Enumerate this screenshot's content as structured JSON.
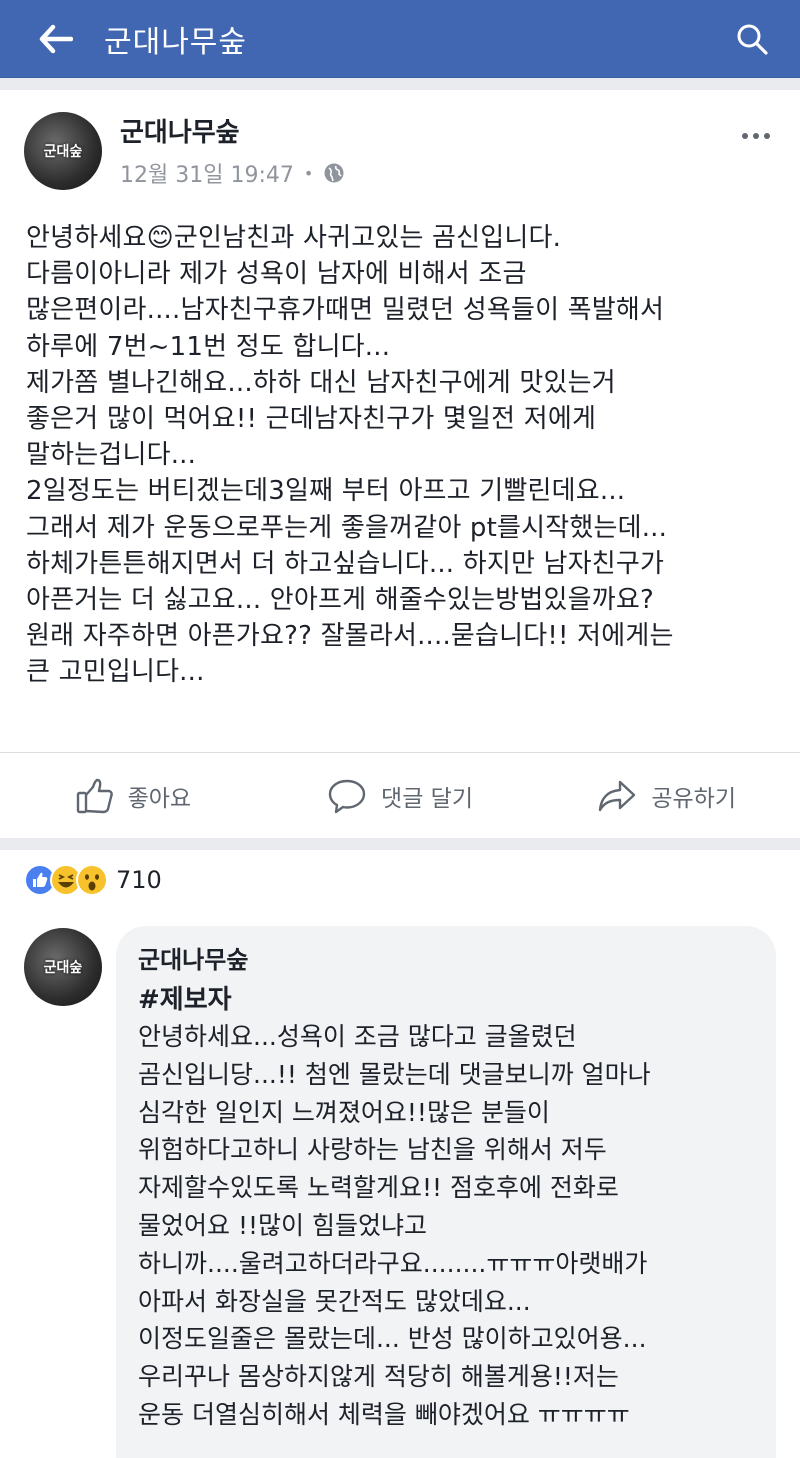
{
  "topbar": {
    "title": "군대나무숲",
    "back_icon": "arrow-left-icon",
    "search_icon": "search-icon",
    "color": "#4267b2"
  },
  "post": {
    "author": "군대나무숲",
    "avatar_text": "군대숲",
    "timestamp": "12월 31일 19:47",
    "separator": "•",
    "privacy_icon": "globe-icon",
    "body": "안녕하세요😊군인남친과 사귀고있는 곰신입니다.\n다름이아니라 제가 성욕이 남자에 비해서 조금\n많은편이라....남자친구휴가때면 밀렸던 성욕들이 폭발해서\n하루에 7번~11번 정도 합니다...\n제가쫌 별나긴해요...하하 대신 남자친구에게 맛있는거\n좋은거 많이 먹어요!! 근데남자친구가 몇일전 저에게\n말하는겁니다...\n2일정도는 버티겠는데3일째 부터 아프고 기빨린데요...\n그래서 제가 운동으로푸는게 좋을꺼같아 pt를시작했는데...\n하체가튼튼해지면서 더 하고싶습니다... 하지만 남자친구가\n아픈거는 더 싫고요... 안아프게 해줄수있는방법있을까요?\n원래 자주하면 아픈가요?? 잘몰라서....묻습니다!! 저에게는\n큰 고민입니다...",
    "actions": {
      "like": "좋아요",
      "comment": "댓글 달기",
      "share": "공유하기"
    }
  },
  "reactions": {
    "icons": [
      "like-icon",
      "haha-icon",
      "wow-icon"
    ],
    "count": "710"
  },
  "comment": {
    "author": "군대나무숲",
    "avatar_text": "군대숲",
    "tag": "#제보자",
    "body": "안녕하세요...성욕이 조금 많다고 글올렸던\n곰신입니당...!! 첨엔 몰랐는데 댓글보니까 얼마나\n심각한 일인지 느껴졌어요!!많은 분들이\n위험하다고하니 사랑하는 남친을 위해서 저두\n자제할수있도록 노력할게요!! 점호후에 전화로\n물었어요 !!많이 힘들었냐고\n하니까....울려고하더라구요........ㅠㅠㅠ아랫배가\n아파서 화장실을 못간적도 많았데요...\n이정도일줄은 몰랐는데... 반성 많이하고있어용...\n우리꾸나 몸상하지않게 적당히 해볼게용!!저는\n운동 더열심히해서 체력을 빼야겠어요 ㅠㅠㅠㅠ"
  }
}
